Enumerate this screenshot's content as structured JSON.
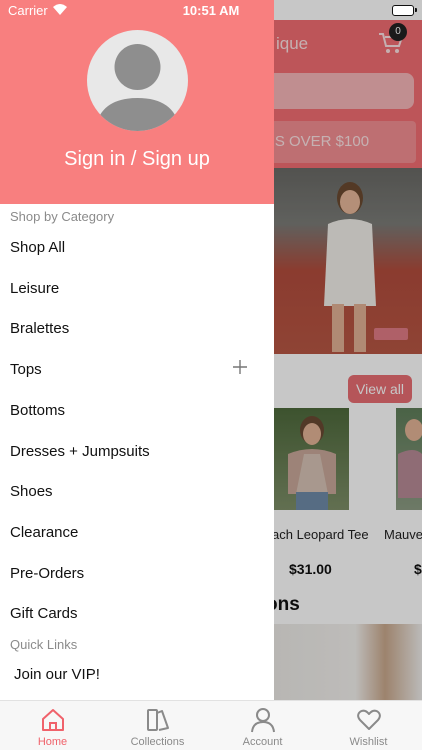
{
  "status_bar": {
    "carrier": "Carrier",
    "time": "10:51 AM"
  },
  "drawer": {
    "sign_in_label": "Sign in / Sign up",
    "category_heading": "Shop by Category",
    "categories": [
      "Shop All",
      "Leisure",
      "Bralettes",
      "Tops",
      "Bottoms",
      "Dresses + Jumpsuits",
      "Shoes",
      "Clearance",
      "Pre-Orders",
      "Gift Cards"
    ],
    "quick_links_heading": "Quick Links",
    "quick_links": [
      "Join our VIP!"
    ]
  },
  "background": {
    "header_title_fragment": "ique",
    "cart_count": "0",
    "promo_fragment": "RS OVER $100",
    "view_all_label": "View all",
    "products": [
      {
        "name": "ach Leopard Tee",
        "price": "$31.00"
      },
      {
        "name": "Mauve",
        "price": "$"
      }
    ],
    "section_title_fragment": "ons"
  },
  "tabbar": {
    "tabs": [
      {
        "label": "Home",
        "icon": "home-icon",
        "active": true
      },
      {
        "label": "Collections",
        "icon": "collections-icon",
        "active": false
      },
      {
        "label": "Account",
        "icon": "account-icon",
        "active": false
      },
      {
        "label": "Wishlist",
        "icon": "heart-icon",
        "active": false
      }
    ]
  },
  "colors": {
    "drawer_header": "#f87f7f",
    "active_tab": "#f0626b",
    "inactive_tab": "#8a8a8a"
  }
}
